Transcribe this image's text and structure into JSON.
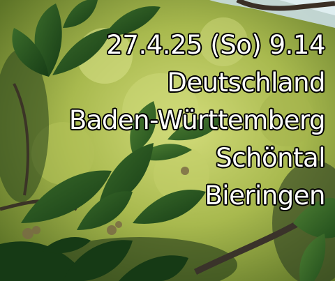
{
  "photo": {
    "icon": "chestnut-leaves-photo",
    "colors": {
      "sky": "#cfe3ea",
      "foliage_light": "#b7c85a",
      "foliage_mid": "#6f8a2e",
      "leaf_dark": "#1f4a1c",
      "leaf_shadow": "#102a12",
      "branch": "#3a2f25"
    }
  },
  "overlay": {
    "text_color": "#ffffff",
    "outline_color": "#000000",
    "lines": {
      "datetime": "27.4.25 (So) 9.14",
      "country": "Deutschland",
      "state": "Baden-Württemberg",
      "municipality": "Schöntal",
      "locality": "Bieringen"
    }
  }
}
